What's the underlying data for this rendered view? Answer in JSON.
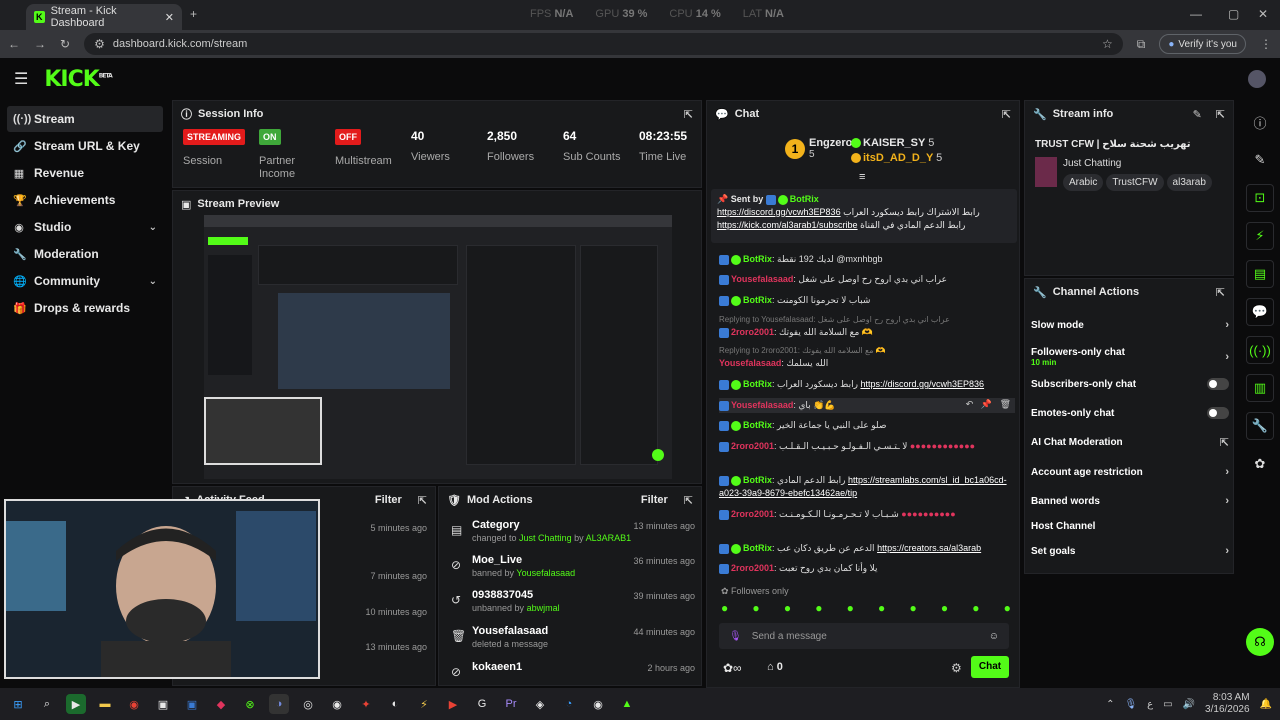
{
  "browser": {
    "tab_title": "Stream - Kick Dashboard",
    "url": "dashboard.kick.com/stream",
    "verify_label": "Verify it's you",
    "stats": [
      {
        "label": "FPS",
        "value": "N/A"
      },
      {
        "label": "GPU",
        "value": "39 %"
      },
      {
        "label": "CPU",
        "value": "14 %"
      },
      {
        "label": "LAT",
        "value": "N/A"
      }
    ]
  },
  "header": {
    "logo": "KICK",
    "logo_sup": "BETA"
  },
  "sidebar": {
    "items": [
      {
        "label": "Stream",
        "icon": "radio-icon"
      },
      {
        "label": "Stream URL & Key",
        "icon": "link-icon"
      },
      {
        "label": "Revenue",
        "icon": "chart-icon"
      },
      {
        "label": "Achievements",
        "icon": "trophy-icon"
      },
      {
        "label": "Studio",
        "icon": "studio-icon"
      },
      {
        "label": "Moderation",
        "icon": "wrench-icon"
      },
      {
        "label": "Community",
        "icon": "globe-icon"
      },
      {
        "label": "Drops & rewards",
        "icon": "gift-icon"
      }
    ]
  },
  "session": {
    "title": "Session Info",
    "items": [
      {
        "badge": "STREAMING",
        "label": "Session",
        "color": "#e31b1b"
      },
      {
        "badge": "ON",
        "label": "Partner Income",
        "color": "#3fa83a"
      },
      {
        "badge": "OFF",
        "label": "Multistream",
        "color": "#e31b1b"
      },
      {
        "value": "40",
        "label": "Viewers"
      },
      {
        "value": "2,850",
        "label": "Followers"
      },
      {
        "value": "64",
        "label": "Sub Counts"
      },
      {
        "value": "08:23:55",
        "label": "Time Live"
      }
    ]
  },
  "preview": {
    "title": "Stream Preview"
  },
  "activity": {
    "title": "Activity Feed",
    "filter": "Filter",
    "times": [
      "5 minutes ago",
      "7 minutes ago",
      "10 minutes ago",
      "13 minutes ago"
    ]
  },
  "mod_actions": {
    "title": "Mod Actions",
    "filter": "Filter",
    "rows": [
      {
        "title": "Category",
        "pre": "changed to ",
        "h1": "Just Chatting",
        "mid": " by ",
        "h2": "AL3ARAB1",
        "time": "13 minutes ago"
      },
      {
        "title": "Moe_Live",
        "pre": "banned by ",
        "h1": "Yousefalasaad",
        "mid": "",
        "h2": "",
        "time": "36 minutes ago"
      },
      {
        "title": "0938837045",
        "pre": "unbanned by ",
        "h1": "abwjmal",
        "mid": "",
        "h2": "",
        "time": "39 minutes ago"
      },
      {
        "title": "Yousefalasaad",
        "pre": "deleted a message",
        "h1": "",
        "mid": "",
        "h2": "",
        "time": "44 minutes ago"
      },
      {
        "title": "kokaeen1",
        "pre": "",
        "h1": "",
        "mid": "",
        "h2": "",
        "time": "2 hours ago"
      }
    ]
  },
  "chat": {
    "title": "Chat",
    "top_users": [
      {
        "name": "Engzero",
        "count": "5",
        "rank": "1"
      },
      {
        "name": "KAISER_SY",
        "count": "5"
      },
      {
        "name": "itsD_AD_D_Y",
        "count": "5"
      }
    ],
    "pinned": {
      "sent_by_label": "Sent by",
      "sender": "BotRix",
      "line1_text": "رابط الاشتراك رابط ديسكورد العراب",
      "line1_link": "https://discord.gg/vcwh3EP836",
      "line2_text": "رابط الدعم المادي في القناة",
      "line2_link": "https://kick.com/al3arab1/subscribe"
    },
    "messages": [
      {
        "user": "BotRix",
        "text": "لديك 192 نقطة @mxnhbgb",
        "color": "gold"
      },
      {
        "user": "Yousefalasaad",
        "text": "عراب اني بدي اروح رح اوصل على شغل",
        "color": "red"
      },
      {
        "user": "BotRix",
        "text": "شباب لا تحرمونا الكومنت",
        "color": "gold"
      },
      {
        "reply": "Replying to Yousefalasaad: عراب اني بدي اروح رح اوصل على شغل"
      },
      {
        "user": "2roro2001",
        "text": "مع السلامة الله يفوتك 🫶",
        "color": "red"
      },
      {
        "reply": "Replying to 2roro2001: مع السلامه الله يفوتك 🫶"
      },
      {
        "user": "Yousefalasaad",
        "text": "الله يسلمك",
        "color": "red"
      },
      {
        "user": "BotRix",
        "text": "رابط ديسكورد العراب",
        "link": "https://discord.gg/vcwh3EP836",
        "color": "gold"
      },
      {
        "user": "Yousefalasaad",
        "text": "باي 👏💪",
        "color": "red"
      },
      {
        "user": "BotRix",
        "text": "صلو على النبي يا جماعة الخير",
        "color": "gold"
      },
      {
        "user": "2roro2001",
        "text": "لا ـتـسـي الـفـولـو حـبـيـب الـقـلـب",
        "color": "red"
      },
      {
        "user": "BotRix",
        "text": "رابط الدعم المادي",
        "link": "https://streamlabs.com/sl_id_bc1a06cd-a023-39a9-8679-ebefc13462ae/tip",
        "color": "gold"
      },
      {
        "user": "2roro2001",
        "text": "شـبـاب لا تـحـرمـونـا الـكـومـنـت",
        "color": "red"
      },
      {
        "user": "BotRix",
        "text": "الدعم عن طريق دكان عب",
        "link": "https://creators.sa/al3arab",
        "color": "gold"
      },
      {
        "user": "2roro2001",
        "text": "يلا وأنا كمان بدي روح تعبت",
        "color": "red"
      }
    ],
    "followers_only": "Followers only",
    "placeholder": "Send a message",
    "points": "0",
    "chat_button": "Chat"
  },
  "stream_info": {
    "title": "Stream info",
    "stream_title": "TRUST CFW | تهريب شحنة سلاح",
    "category": "Just Chatting",
    "tags": [
      "Arabic",
      "TrustCFW",
      "al3arab"
    ]
  },
  "channel_actions": {
    "title": "Channel Actions",
    "rows": [
      {
        "label": "Slow mode",
        "kind": "chevron"
      },
      {
        "label": "Followers-only chat",
        "sub": "10 min",
        "kind": "chevron"
      },
      {
        "label": "Subscribers-only chat",
        "kind": "toggle"
      },
      {
        "label": "Emotes-only chat",
        "kind": "toggle"
      },
      {
        "label": "AI Chat Moderation",
        "kind": "external"
      },
      {
        "label": "Account age restriction",
        "kind": "chevron"
      },
      {
        "label": "Banned words",
        "kind": "chevron"
      },
      {
        "label": "Host Channel",
        "kind": "none"
      },
      {
        "label": "Set goals",
        "kind": "chevron"
      }
    ]
  },
  "taskbar": {
    "time": "8:03 AM",
    "date": "3/16/2026"
  }
}
